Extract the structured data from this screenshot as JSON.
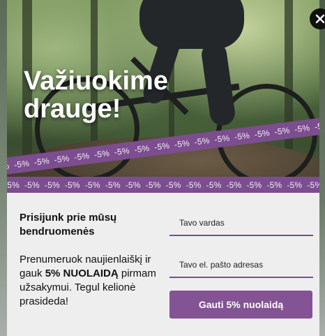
{
  "hero": {
    "headline_line1": "Važiuokime",
    "headline_line2": "drauge!",
    "ribbon_text": "-5%"
  },
  "close": {
    "icon": "close-icon"
  },
  "signup": {
    "title": "Prisijunk prie mūsų bendruomenės",
    "desc_before": "Prenumeruok naujienlaiškį ir gauk ",
    "desc_bold": "5% NUOLAIDĄ",
    "desc_after": " pirmam užsakymui. Tegul kelionė prasideda!",
    "name_placeholder": "Tavo vardas",
    "email_placeholder": "Tavo el. pašto adresas",
    "submit_label": "Gauti 5% nuolaidą"
  },
  "colors": {
    "accent": "#835394",
    "ribbon": "#7c4d8f",
    "panel": "#eeeeef"
  }
}
